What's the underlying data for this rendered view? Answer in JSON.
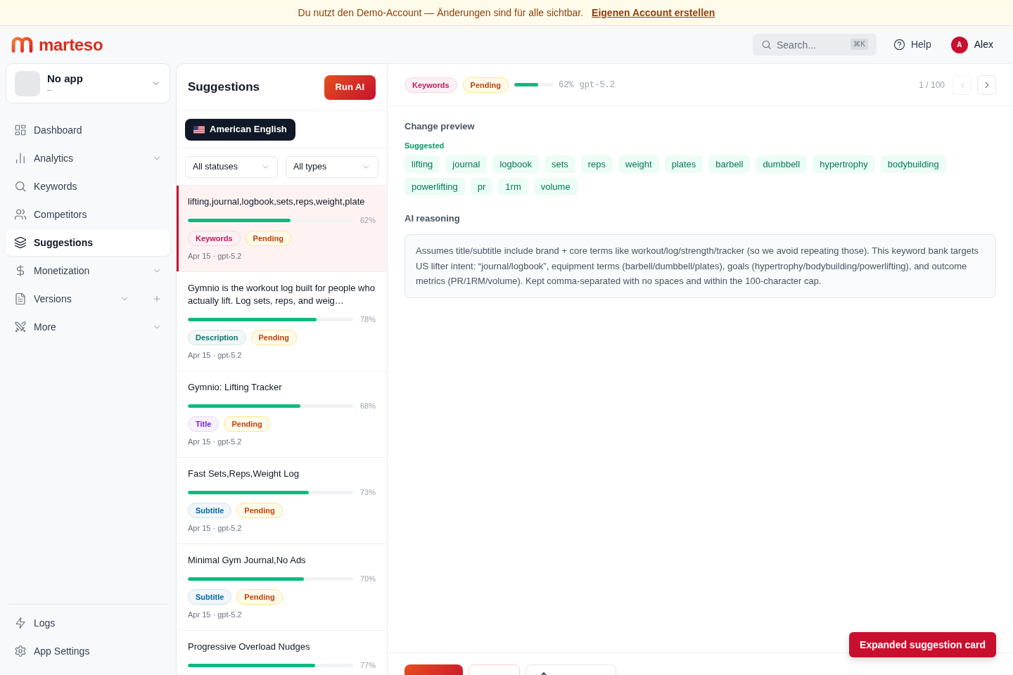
{
  "banner": {
    "text": "Du nutzt den Demo-Account — Änderungen sind für alle sichtbar.",
    "link": "Eigenen Account erstellen"
  },
  "header": {
    "logo": "marteso",
    "search": {
      "placeholder": "Search...",
      "shortcut": "⌘K"
    },
    "help": "Help",
    "user": {
      "initial": "A",
      "name": "Alex"
    }
  },
  "sidebar": {
    "app_picker": {
      "name": "No app",
      "subtitle": "–"
    },
    "items": [
      {
        "label": "Dashboard",
        "selected": false
      },
      {
        "label": "Analytics",
        "selected": false,
        "expanded": false
      },
      {
        "label": "Keywords",
        "selected": false
      },
      {
        "label": "Competitors",
        "selected": false
      },
      {
        "label": "Suggestions",
        "selected": true
      },
      {
        "label": "Monetization",
        "selected": false,
        "expanded": false
      },
      {
        "label": "Versions",
        "selected": false,
        "expanded": false,
        "add": true
      },
      {
        "label": "More",
        "selected": false,
        "expanded": false
      }
    ],
    "footer_items": [
      {
        "label": "Logs",
        "selected": false
      },
      {
        "label": "App Settings",
        "selected": false
      }
    ]
  },
  "suggestions_panel": {
    "title": "Suggestions",
    "run_button": "Run AI",
    "language": "American English",
    "filters": [
      {
        "value": "All statuses"
      },
      {
        "value": "All types"
      }
    ],
    "items": [
      {
        "title": "lifting,journal,logbook,sets,reps,weight,plate",
        "level": 0.62,
        "percent": "62%",
        "type_tag": {
          "label": "Keywords",
          "color": "#c0185f"
        },
        "status": "Pending",
        "meta": "Apr 15 · gpt-5.2",
        "selected": true
      },
      {
        "title": "Gymnio is the workout log built for people who actually lift. Log sets, reps, and weig…",
        "level": 0.78,
        "percent": "78%",
        "type_tag": {
          "label": "Description",
          "color": "#0f766e"
        },
        "status": "Pending",
        "meta": "Apr 15 · gpt-5.2",
        "selected": false
      },
      {
        "title": "Gymnio: Lifting Tracker",
        "level": 0.68,
        "percent": "68%",
        "type_tag": {
          "label": "Title",
          "color": "#7e22ce"
        },
        "status": "Pending",
        "meta": "Apr 15 · gpt-5.2",
        "selected": false
      },
      {
        "title": "Fast Sets,Reps,Weight Log",
        "level": 0.73,
        "percent": "73%",
        "type_tag": {
          "label": "Subtitle",
          "color": "#0369a1"
        },
        "status": "Pending",
        "meta": "Apr 15 · gpt-5.2",
        "selected": false
      },
      {
        "title": "Minimal Gym Journal,No Ads",
        "level": 0.7,
        "percent": "70%",
        "type_tag": {
          "label": "Subtitle",
          "color": "#0369a1"
        },
        "status": "Pending",
        "meta": "Apr 15 · gpt-5.2",
        "selected": false
      },
      {
        "title": "Progressive Overload Nudges",
        "level": 0.77,
        "percent": "77%",
        "selected": false
      }
    ]
  },
  "detail": {
    "type_tag": {
      "label": "Keywords",
      "color": "#c0185f"
    },
    "status": "Pending",
    "level": 0.62,
    "percent": "62%",
    "model": "gpt-5.2",
    "pager": {
      "text": "1 / 100",
      "prev_disabled": true,
      "next_disabled": false
    },
    "preview_heading": "Change preview",
    "suggested_label": "Suggested",
    "keywords": [
      "lifting",
      "journal",
      "logbook",
      "sets",
      "reps",
      "weight",
      "plates",
      "barbell",
      "dumbbell",
      "hypertrophy",
      "bodybuilding",
      "powerlifting",
      "pr",
      "1rm",
      "volume"
    ],
    "reasoning_heading": "AI reasoning",
    "reasoning": "Assumes title/subtitle include brand + core terms like workout/log/strength/tracker (so we avoid repeating those). This keyword bank targets US lifter intent: “journal/logbook”, equipment terms (barbell/dumbbell/plates), goals (hypertrophy/bodybuilding/powerlifting), and outcome metrics (PR/1RM/volume). Kept comma-separated with no spaces and within the 100-character cap.",
    "action_buttons": [
      {
        "kind": "primary"
      },
      {
        "kind": "danger"
      },
      {
        "kind": "upload"
      }
    ]
  },
  "toast": {
    "text": "Expanded suggestion card"
  }
}
